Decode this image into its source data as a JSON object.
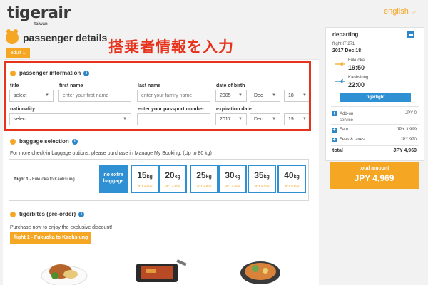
{
  "header": {
    "logo_main": "tigerair",
    "logo_sub": "taiwan",
    "language": "english"
  },
  "page": {
    "title": "passenger details",
    "annotation_jp": "搭乗者情報を入力",
    "adult_tab": "adult 1"
  },
  "passenger_info": {
    "heading": "passenger information",
    "title_label": "title",
    "title_value": "select",
    "first_name_label": "first name",
    "first_name_placeholder": "enter your first name",
    "last_name_label": "last name",
    "last_name_placeholder": "enter your family name",
    "dob_label": "date of birth",
    "dob_year": "2005",
    "dob_month": "Dec",
    "dob_day": "18",
    "nationality_label": "nationality",
    "nationality_value": "select",
    "passport_label": "enter your passport number",
    "passport_value": "",
    "expiry_label": "expiration date",
    "expiry_year": "2017",
    "expiry_month": "Dec",
    "expiry_day": "19"
  },
  "baggage": {
    "heading": "baggage selection",
    "note": "For more check-in baggage options, please purchase in Manage My Booking. (Up to 80 kg)",
    "flight_label": "flight 1",
    "flight_route": " - Fukuoka to Kaohsiung",
    "no_extra": "no extra baggage",
    "options": [
      {
        "kg": "15",
        "unit": "kg",
        "price": "JPY 2,500"
      },
      {
        "kg": "20",
        "unit": "kg",
        "price": "JPY 2,900"
      },
      {
        "kg": "25",
        "unit": "kg",
        "price": "JPY 3,500"
      },
      {
        "kg": "30",
        "unit": "kg",
        "price": "JPY 4,400"
      },
      {
        "kg": "35",
        "unit": "kg",
        "price": "JPY 5,400"
      },
      {
        "kg": "40",
        "unit": "kg",
        "price": "JPY 6,800"
      }
    ]
  },
  "tigerbites": {
    "heading": "tigerbites (pre-order)",
    "note": "Purchase now to enjoy the exclusive discount!",
    "flight_button": "flight 1 - Fukuoka to Kaohsiung"
  },
  "summary": {
    "heading": "departing",
    "flight_no": "flight IT 271",
    "date": "2017 Dec 18",
    "from_city": "Fukuoka",
    "dep_time": "19:50",
    "to_city": "Kaohsiung",
    "arr_time": "22:00",
    "fare_type": "tigerlight",
    "addon_label": "Add-on service",
    "addon_value": "JPY 0",
    "fare_label": "Fare",
    "fare_value": "JPY 3,999",
    "fees_label": "Fees & taxes",
    "fees_value": "JPY 970",
    "total_label": "total",
    "total_value": "JPY 4,969",
    "total_amount_label": "total amount",
    "total_amount_value": "JPY 4,969"
  },
  "colors": {
    "brand_orange": "#f5a623",
    "brand_blue": "#2f91d3",
    "annotation_red": "#e8331c"
  }
}
